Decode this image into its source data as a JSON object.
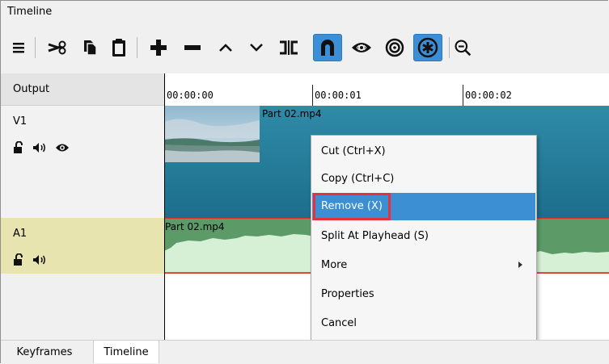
{
  "window": {
    "title": "Timeline"
  },
  "toolbar": {
    "buttons": [
      {
        "name": "menu-icon"
      },
      {
        "name": "cut-icon"
      },
      {
        "name": "copy-icon"
      },
      {
        "name": "paste-icon"
      },
      {
        "name": "append-icon"
      },
      {
        "name": "remove-icon"
      },
      {
        "name": "lift-icon"
      },
      {
        "name": "overwrite-icon"
      },
      {
        "name": "split-icon"
      },
      {
        "name": "snap-icon",
        "active": true
      },
      {
        "name": "scrub-icon"
      },
      {
        "name": "ripple-icon"
      },
      {
        "name": "ripple-all-icon",
        "active": true
      },
      {
        "name": "zoom-out-icon"
      }
    ]
  },
  "tracks": {
    "output_label": "Output",
    "v1_label": "V1",
    "a1_label": "A1"
  },
  "ruler": {
    "ticks": [
      "00:00:00",
      "00:00:01",
      "00:00:02"
    ]
  },
  "clips": {
    "video_name": "Part 02.mp4",
    "audio_name": "Part 02.mp4"
  },
  "context_menu": {
    "items": [
      {
        "label": "Cut (Ctrl+X)"
      },
      {
        "label": "Copy (Ctrl+C)"
      },
      {
        "label": "Remove (X)",
        "selected": true
      },
      {
        "label": "Split At Playhead (S)"
      },
      {
        "label": "More",
        "submenu": true
      },
      {
        "label": "Properties"
      },
      {
        "label": "Cancel"
      }
    ]
  },
  "tabs": [
    {
      "label": "Keyframes"
    },
    {
      "label": "Timeline",
      "active": true
    }
  ],
  "colors": {
    "accent": "#3b8fd2",
    "highlight": "#e8303a",
    "video_clip": "#2d89a6",
    "audio_clip": "#5c9b68",
    "audio_track_head": "#e8e4b0"
  }
}
